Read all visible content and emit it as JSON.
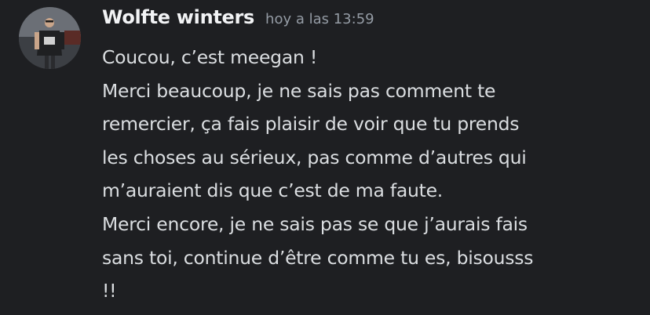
{
  "message": {
    "author": "Wolfte winters",
    "timestamp": "hoy a las 13:59",
    "lines": [
      "Coucou, c’est meegan !",
      "Merci beaucoup, je ne sais pas comment te",
      "remercier, ça fais plaisir de voir que tu prends",
      "les choses au sérieux, pas comme d’autres qui",
      "m’auraient dis que c’est de ma faute.",
      "Merci encore, je ne sais pas se que j’aurais fais",
      "sans toi, continue d’être comme tu es, bisousss",
      "!!"
    ]
  },
  "colors": {
    "background": "#1e1f22",
    "username": "#f2f3f5",
    "timestamp": "#949ba4",
    "text": "#dbdee1"
  },
  "icons": {
    "avatar": "user-avatar-character"
  }
}
